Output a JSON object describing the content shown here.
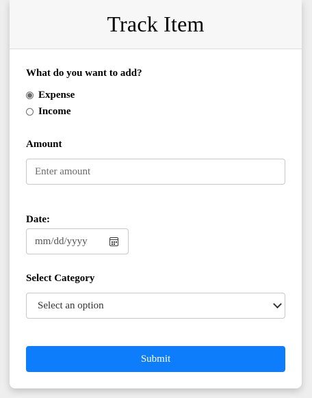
{
  "header": {
    "title": "Track Item"
  },
  "form": {
    "type_label": "What do you want to add?",
    "types": [
      {
        "label": "Expense",
        "checked": true
      },
      {
        "label": "Income",
        "checked": false
      }
    ],
    "amount_label": "Amount",
    "amount_placeholder": "Enter amount",
    "date_label": "Date:",
    "date_placeholder": "mm/dd/yyyy",
    "category_label": "Select Category",
    "category_selected": "Select an option",
    "submit_label": "Submit"
  },
  "colors": {
    "accent": "#0d7dfb",
    "header_bg": "#f7f7f7"
  },
  "icons": {
    "date": "calendar-icon",
    "select": "chevron-down-icon"
  }
}
